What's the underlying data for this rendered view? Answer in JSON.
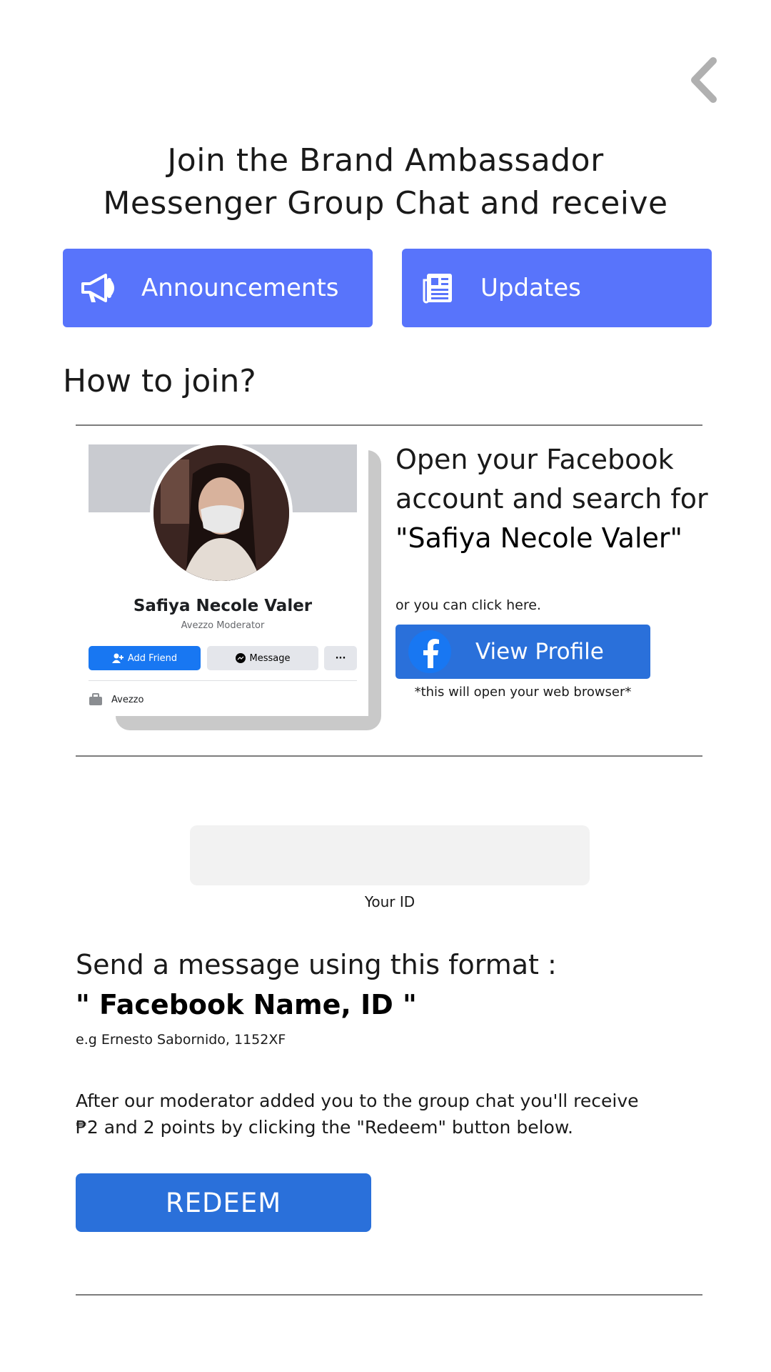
{
  "header": {
    "title_line1": "Join the Brand Ambassador",
    "title_line2": "Messenger Group Chat and receive"
  },
  "benefits": [
    {
      "label": "Announcements",
      "icon": "megaphone-icon"
    },
    {
      "label": "Updates",
      "icon": "newspaper-icon"
    }
  ],
  "howto": {
    "heading": "How to join?",
    "instruction_line1": "Open your Facebook",
    "instruction_line2": "account and search for",
    "search_name": "\"Safiya Necole Valer\"",
    "click_here": "or you can click here.",
    "view_profile_label": "View Profile",
    "browser_note": "*this will open your web browser*"
  },
  "fb_card": {
    "name": "Safiya Necole Valer",
    "subtitle": "Avezzo Moderator",
    "add_friend": "Add Friend",
    "message": "Message",
    "more": "···",
    "work": "Avezzo"
  },
  "id_field": {
    "value": "",
    "label": "Your ID"
  },
  "message_format": {
    "line1": "Send a message using this format :",
    "format": "\" Facebook Name, ID \"",
    "example": "e.g Ernesto Sabornido, 1152XF"
  },
  "reward": {
    "text_line1": "After our moderator added you to the group chat you'll receive",
    "text_line2": "₱2 and 2 points by clicking the \"Redeem\" button below."
  },
  "redeem_label": "REDEEM",
  "colors": {
    "benefit_bg": "#5874fb",
    "primary_button": "#2a70da",
    "facebook_blue": "#1877f2"
  }
}
